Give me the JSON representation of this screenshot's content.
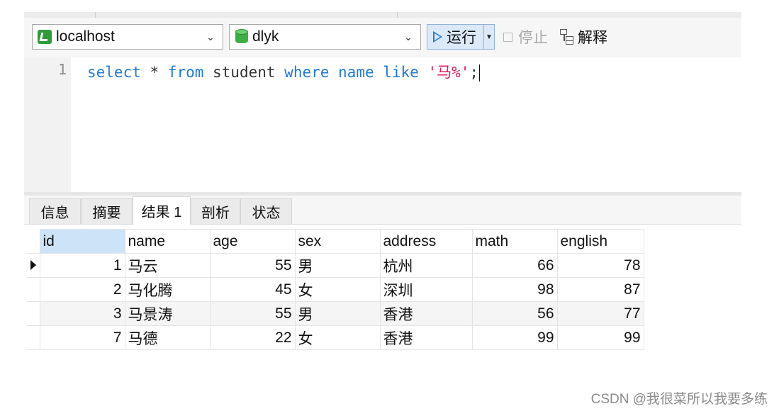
{
  "toolbar": {
    "connection": "localhost",
    "database": "dlyk",
    "run_label": "运行",
    "stop_label": "停止",
    "explain_label": "解释"
  },
  "editor": {
    "line_number": "1",
    "tokens": {
      "select": "select",
      "star": " * ",
      "from": "from",
      "table": " student ",
      "where": "where",
      "col": " name ",
      "like": "like",
      "space": " ",
      "literal": "'马%'",
      "semicolon": ";"
    }
  },
  "result_tabs": [
    "信息",
    "摘要",
    "结果 1",
    "剖析",
    "状态"
  ],
  "active_tab": "结果 1",
  "grid": {
    "columns": [
      "id",
      "name",
      "age",
      "sex",
      "address",
      "math",
      "english"
    ],
    "rows": [
      [
        "1",
        "马云",
        "55",
        "男",
        "杭州",
        "66",
        "78"
      ],
      [
        "2",
        "马化腾",
        "45",
        "女",
        "深圳",
        "98",
        "87"
      ],
      [
        "3",
        "马景涛",
        "55",
        "男",
        "香港",
        "56",
        "77"
      ],
      [
        "7",
        "马德",
        "22",
        "女",
        "香港",
        "99",
        "99"
      ]
    ],
    "current_row": 0
  },
  "colors": {
    "keyword": "#1f7ad6",
    "string": "#e0185f",
    "run_button_bg": "#dce9f8",
    "selected_header": "#cde3f7"
  },
  "icons": {
    "connection": "connection-icon",
    "database": "database-icon",
    "run": "play-icon",
    "stop": "stop-icon",
    "explain": "explain-icon"
  },
  "watermark": "CSDN @我很菜所以我要多练"
}
